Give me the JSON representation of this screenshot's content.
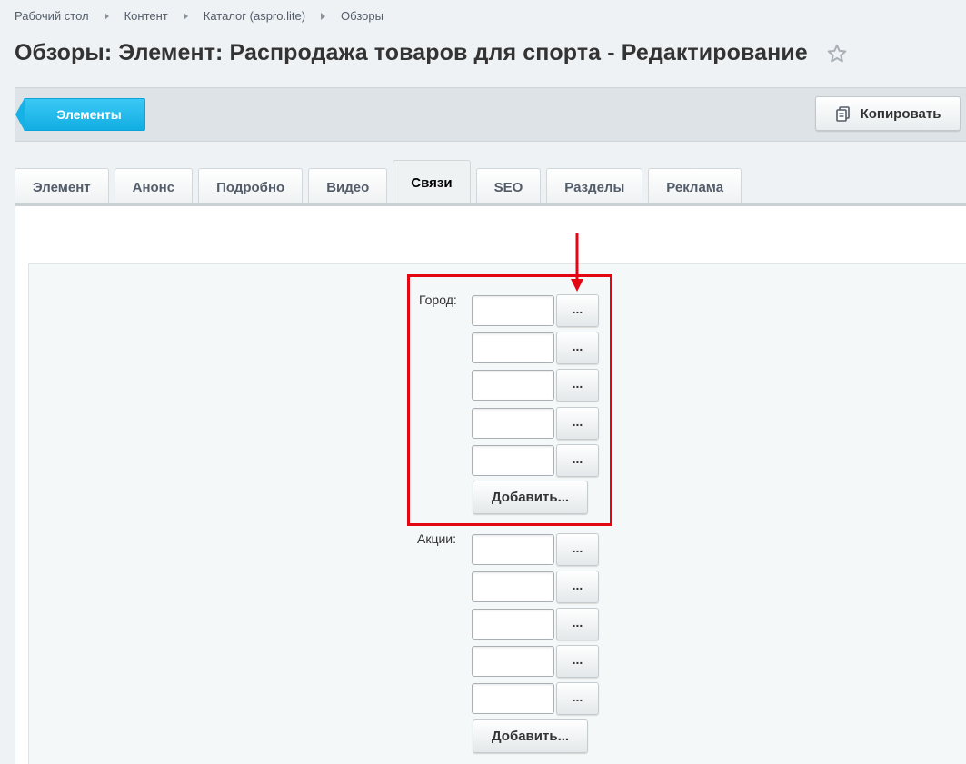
{
  "breadcrumb": [
    "Рабочий стол",
    "Контент",
    "Каталог (aspro.lite)",
    "Обзоры"
  ],
  "page_title": "Обзоры: Элемент: Распродажа товаров для спорта - Редактирование",
  "toolbar": {
    "back_label": "Элементы",
    "copy_label": "Копировать"
  },
  "tabs": [
    "Элемент",
    "Анонс",
    "Подробно",
    "Видео",
    "Связи",
    "SEO",
    "Разделы",
    "Реклама"
  ],
  "active_tab": "Связи",
  "fields": [
    {
      "label": "Город:",
      "inputs": [
        "",
        "",
        "",
        "",
        ""
      ],
      "pick_label": "...",
      "add_label": "Добавить..."
    },
    {
      "label": "Акции:",
      "inputs": [
        "",
        "",
        "",
        "",
        ""
      ],
      "pick_label": "...",
      "add_label": "Добавить..."
    }
  ],
  "colors": {
    "accent": "#12aee2",
    "annotation": "#e30613"
  },
  "icons": [
    "star-icon",
    "copy-icon",
    "arrow-annotation"
  ]
}
